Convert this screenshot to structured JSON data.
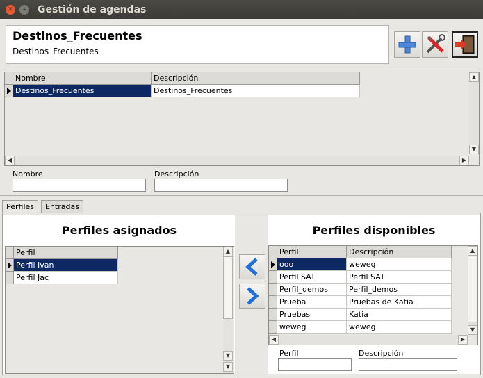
{
  "window": {
    "title": "Gestión de agendas"
  },
  "header": {
    "title": "Destinos_Frecuentes",
    "subtitle": "Destinos_Frecuentes"
  },
  "agendas_table": {
    "columns": [
      "Nombre",
      "Descripción"
    ],
    "rows": [
      {
        "nombre": "Destinos_Frecuentes",
        "descripcion": "Destinos_Frecuentes"
      }
    ]
  },
  "agenda_form": {
    "nombre_label": "Nombre",
    "descripcion_label": "Descripción",
    "nombre_value": "",
    "descripcion_value": ""
  },
  "tabs": [
    {
      "label": "Perfiles"
    },
    {
      "label": "Entradas"
    }
  ],
  "assigned": {
    "title": "Perfiles asignados",
    "columns": [
      "Perfil"
    ],
    "rows": [
      {
        "perfil": "Perfil Ivan"
      },
      {
        "perfil": "Perfil Jac"
      }
    ]
  },
  "available": {
    "title": "Perfiles disponibles",
    "columns": [
      "Perfil",
      "Descripción"
    ],
    "rows": [
      {
        "perfil": "ooo",
        "descripcion": "weweg"
      },
      {
        "perfil": "Perfil SAT",
        "descripcion": "Perfil SAT"
      },
      {
        "perfil": "Perfil_demos",
        "descripcion": "Perfil_demos"
      },
      {
        "perfil": "Prueba",
        "descripcion": "Pruebas de Katia"
      },
      {
        "perfil": "Pruebas",
        "descripcion": "Katia"
      },
      {
        "perfil": "weweg",
        "descripcion": "weweg"
      }
    ],
    "perfil_label": "Perfil",
    "descripcion_label": "Descripción"
  },
  "colors": {
    "selection": "#0d2862",
    "titlebar": "#3c3b37",
    "arrow": "#1e6fd9"
  }
}
